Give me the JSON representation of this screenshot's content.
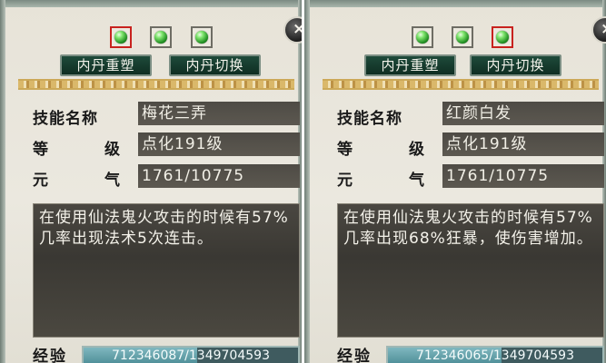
{
  "close_label": "×",
  "panels": [
    {
      "selected_orb": 0,
      "buttons": {
        "reshape": "内丹重塑",
        "switch": "内丹切换"
      },
      "labels": {
        "skill_name": "技能名称",
        "level_a": "等",
        "level_b": "级",
        "vital_a": "元",
        "vital_b": "气",
        "experience": "经验"
      },
      "values": {
        "skill_name": "梅花三弄",
        "level": "点化191级",
        "vital": "1761/10775"
      },
      "description": "在使用仙法鬼火攻击的时候有57%几率出现法术5次连击。",
      "experience": {
        "text": "712346087/1349704593",
        "current": 712346087,
        "max": 1349704593
      }
    },
    {
      "selected_orb": 2,
      "buttons": {
        "reshape": "内丹重塑",
        "switch": "内丹切换"
      },
      "labels": {
        "skill_name": "技能名称",
        "level_a": "等",
        "level_b": "级",
        "vital_a": "元",
        "vital_b": "气",
        "experience": "经验"
      },
      "values": {
        "skill_name": "红颜白发",
        "level": "点化191级",
        "vital": "1761/10775"
      },
      "description": "在使用仙法鬼火攻击的时候有57%几率出现68%狂暴，使伤害增加。",
      "experience": {
        "text": "712346065/1349704593",
        "current": 712346065,
        "max": 1349704593
      }
    }
  ]
}
